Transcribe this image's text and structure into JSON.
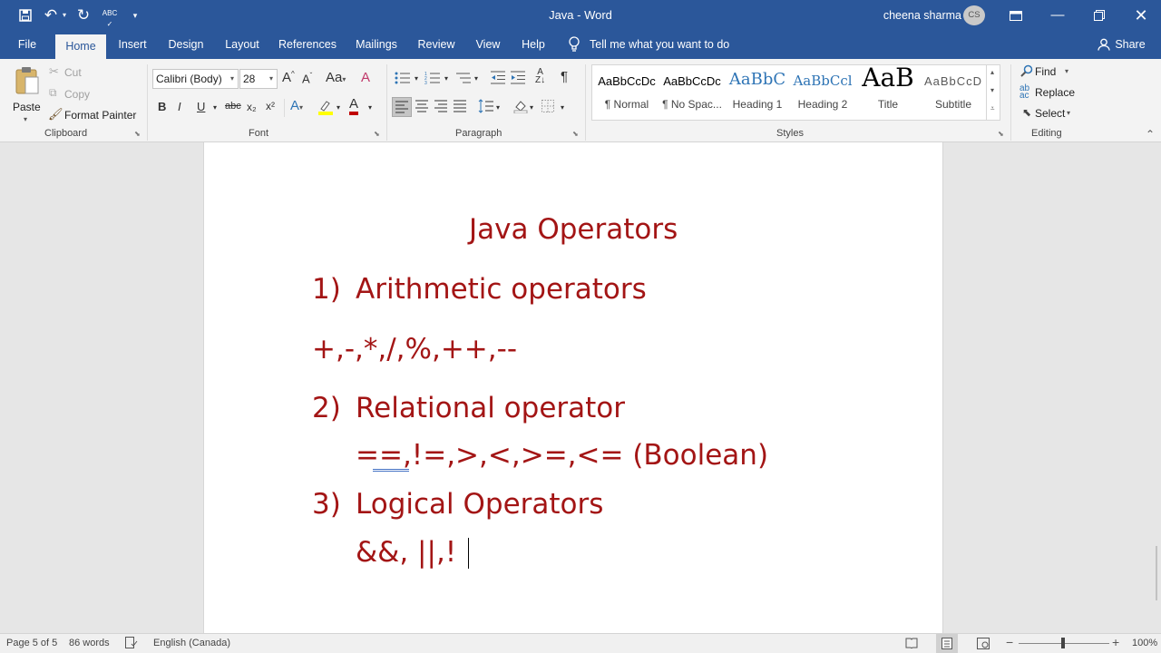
{
  "window": {
    "title": "Java  -  Word",
    "user_name": "cheena sharma",
    "user_initials": "CS"
  },
  "tabs": [
    "File",
    "Home",
    "Insert",
    "Design",
    "Layout",
    "References",
    "Mailings",
    "Review",
    "View",
    "Help"
  ],
  "tell_me": "Tell me what you want to do",
  "share": "Share",
  "clipboard": {
    "paste": "Paste",
    "cut": "Cut",
    "copy": "Copy",
    "format_painter": "Format Painter",
    "label": "Clipboard"
  },
  "font": {
    "name": "Calibri (Body)",
    "size": "28",
    "label": "Font",
    "bold": "B",
    "italic": "I",
    "underline": "U",
    "strike": "abc",
    "subscript": "x₂",
    "superscript": "x²",
    "grow": "A^",
    "shrink": "Aˇ",
    "change_case": "Aa"
  },
  "paragraph": {
    "label": "Paragraph"
  },
  "styles": {
    "label": "Styles",
    "items": [
      {
        "preview": "AaBbCcDc",
        "name": "¶ Normal"
      },
      {
        "preview": "AaBbCcDc",
        "name": "¶ No Spac..."
      },
      {
        "preview": "AaBbC",
        "name": "Heading 1"
      },
      {
        "preview": "AaBbCcl",
        "name": "Heading 2"
      },
      {
        "preview": "AaB",
        "name": "Title"
      },
      {
        "preview": "AaBbCcD",
        "name": "Subtitle"
      }
    ]
  },
  "editing": {
    "find": "Find",
    "replace": "Replace",
    "select": "Select",
    "label": "Editing"
  },
  "document": {
    "title": "Java Operators",
    "item1_num": "1)",
    "item1_text": "Arithmetic operators",
    "item1_ops": "+,-,*,/,%,++,--",
    "item2_num": "2)",
    "item2_text": "Relational operator",
    "item2_ops": "==,!=,>,<,>=,<=  (Boolean)",
    "item3_num": "3)",
    "item3_text": "Logical Operators",
    "item3_ops": "&&, ||,!"
  },
  "status": {
    "page": "Page 5 of 5",
    "words": "86 words",
    "language": "English (Canada)",
    "zoom": "100%"
  },
  "colors": {
    "brand": "#2b579a",
    "doc_text": "#a31515"
  }
}
